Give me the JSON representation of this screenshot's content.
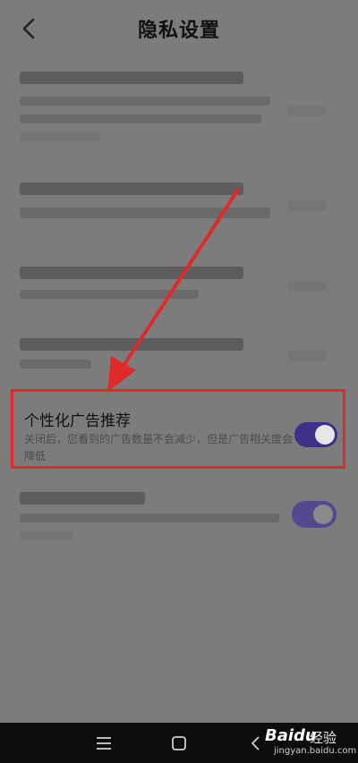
{
  "header": {
    "title": "隐私设置"
  },
  "highlighted_setting": {
    "title": "个性化广告推荐",
    "description": "关闭后，您看到的广告数量不会减少，但是广告相关度会降低",
    "toggle_on": true,
    "toggle_color": "#3d2f8a"
  },
  "annotation": {
    "arrow_color": "#e02a2a",
    "box_color": "#e02a2a"
  },
  "watermark": {
    "brand": "Bai",
    "brand_suffix": "du",
    "product": "经验",
    "url": "jingyan.baidu.com"
  },
  "nav": {
    "menu_icon": "menu-icon",
    "home_icon": "square-home-icon",
    "back_icon": "back-triangle-icon"
  }
}
